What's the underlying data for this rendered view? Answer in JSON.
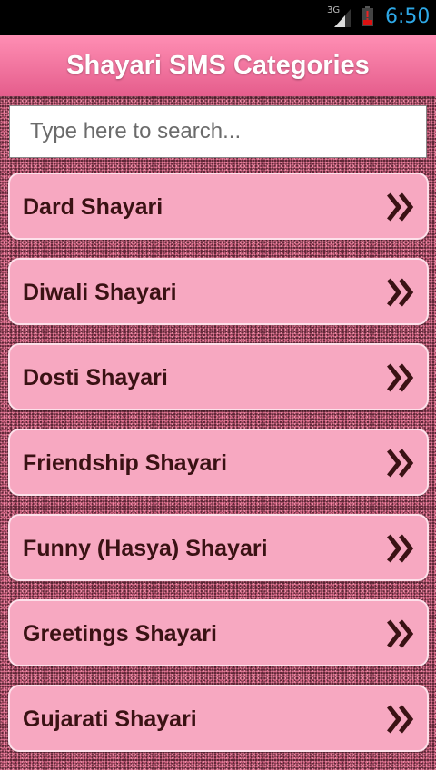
{
  "status_bar": {
    "network": "3G",
    "time": "6:50"
  },
  "header": {
    "title": "Shayari SMS Categories"
  },
  "search": {
    "placeholder": "Type here to search...",
    "value": ""
  },
  "categories": [
    {
      "label": "Dard Shayari"
    },
    {
      "label": "Diwali Shayari"
    },
    {
      "label": "Dosti Shayari"
    },
    {
      "label": "Friendship Shayari"
    },
    {
      "label": "Funny (Hasya) Shayari"
    },
    {
      "label": "Greetings Shayari"
    },
    {
      "label": "Gujarati Shayari"
    }
  ],
  "icons": {
    "item_arrow": "double-chevron-right-icon",
    "signal": "signal-icon",
    "battery": "battery-icon"
  },
  "colors": {
    "header": "#f0709a",
    "item_background": "#f7a8c1",
    "item_text": "#3a1214",
    "time_text": "#2ea8e6"
  }
}
